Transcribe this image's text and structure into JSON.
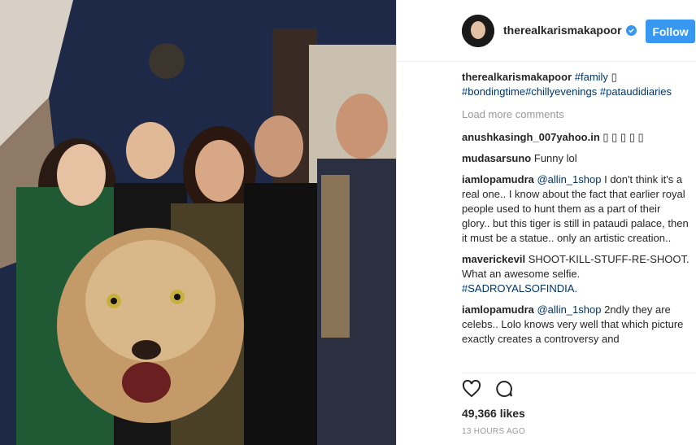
{
  "post": {
    "username": "therealkarismakapoor",
    "follow_label": "Follow",
    "caption_user": "therealkarismakapoor",
    "caption_tags": [
      "#family",
      "#bondingtime",
      "#chillyevenings",
      "#pataudidiaries"
    ],
    "load_more": "Load more comments",
    "comments": [
      {
        "user": "anushkasingh_007yahoo.in",
        "text": "▯ ▯ ▯ ▯ ▯",
        "tags": ""
      },
      {
        "user": "mudasarsuno",
        "text": "Funny lol",
        "tags": ""
      },
      {
        "user": "iamlopamudra",
        "tags": "@allin_1shop",
        "text": "I don't think it's a real one.. I know about the fact that earlier royal people used to hunt them as a part of their glory.. but this tiger is still in pataudi palace, then it must be a statue.. only an artistic creation.."
      },
      {
        "user": "maverickevil",
        "text": "SHOOT-KILL-STUFF-RE-SHOOT. What an awesome selfie.",
        "tags": "#SADROYALSOFINDIA."
      },
      {
        "user": "iamlopamudra",
        "tags": "@allin_1shop",
        "text": "2ndly they are celebs.. Lolo knows very well that which picture exactly creates a controversy and"
      }
    ],
    "likes": "49,366 likes",
    "time": "13 HOURS AGO"
  },
  "icons": {
    "like": "heart-icon",
    "comment": "comment-icon",
    "verified": "verified-badge-icon"
  },
  "colors": {
    "accent": "#3897f0",
    "hashtag": "#003569",
    "muted": "#999999"
  }
}
